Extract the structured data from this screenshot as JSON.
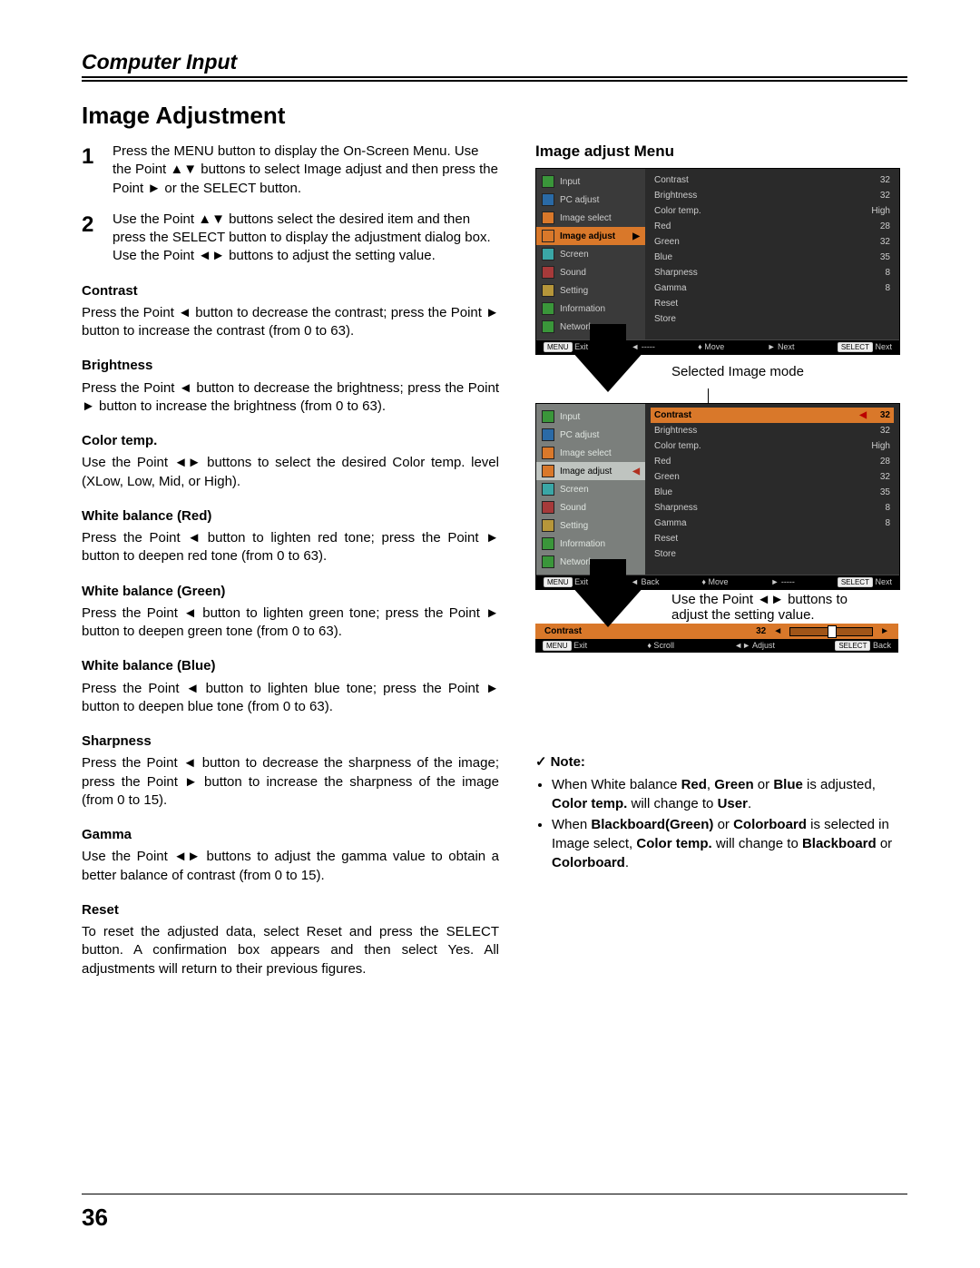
{
  "header": {
    "section": "Computer Input"
  },
  "title": "Image Adjustment",
  "steps": [
    {
      "num": "1",
      "text": "Press the MENU button to display the On-Screen Menu. Use the Point ▲▼ buttons to select Image adjust and then press the Point ► or the SELECT button."
    },
    {
      "num": "2",
      "text": "Use the Point ▲▼ buttons select the desired item and then press the SELECT button to display the adjustment dialog box. Use the Point ◄► buttons to adjust the setting value."
    }
  ],
  "settings": [
    {
      "name": "Contrast",
      "desc": "Press the Point ◄ button to decrease the contrast; press the Point ► button to increase the contrast (from 0 to 63)."
    },
    {
      "name": "Brightness",
      "desc": "Press the Point ◄ button to decrease the brightness; press the Point ► button to increase the brightness (from 0 to 63)."
    },
    {
      "name": "Color temp.",
      "desc": "Use the Point ◄► buttons to select the desired Color temp. level (XLow, Low, Mid, or High)."
    },
    {
      "name": "White balance (Red)",
      "desc": "Press the Point ◄ button to lighten red tone; press the Point ► button to deepen red tone (from 0 to 63)."
    },
    {
      "name": "White balance (Green)",
      "desc": "Press the Point ◄ button to lighten green tone; press the Point ► button to deepen green tone (from 0 to 63)."
    },
    {
      "name": "White balance (Blue)",
      "desc": "Press the Point ◄ button to lighten blue tone; press the Point ► button to deepen blue tone (from 0 to 63)."
    },
    {
      "name": "Sharpness",
      "desc": "Press the Point ◄ button to decrease the sharpness of the image; press the Point ► button to increase the sharpness of the image (from 0 to 15)."
    },
    {
      "name": "Gamma",
      "desc": "Use the Point ◄► buttons to adjust the gamma value to obtain a better balance of contrast (from 0 to 15)."
    },
    {
      "name": "Reset",
      "desc": "To reset the adjusted data, select Reset and press the SELECT button. A confirmation box appears and then select Yes. All adjustments will return to their previous figures."
    }
  ],
  "right": {
    "title": "Image adjust Menu",
    "selected_caption": "Selected Image mode",
    "hint": "Use the Point ◄► buttons to adjust the setting value."
  },
  "osd1": {
    "side": [
      {
        "label": "Input",
        "ic": "grn"
      },
      {
        "label": "PC adjust",
        "ic": "blu"
      },
      {
        "label": "Image select",
        "ic": "org"
      },
      {
        "label": "Image adjust",
        "ic": "org",
        "sel": true
      },
      {
        "label": "Screen",
        "ic": "cyn"
      },
      {
        "label": "Sound",
        "ic": "red"
      },
      {
        "label": "Setting",
        "ic": "yel"
      },
      {
        "label": "Information",
        "ic": "grn"
      },
      {
        "label": "Network",
        "ic": "grn"
      }
    ],
    "main": [
      {
        "k": "Contrast",
        "v": "32"
      },
      {
        "k": "Brightness",
        "v": "32"
      },
      {
        "k": "Color temp.",
        "v": "High"
      },
      {
        "k": "Red",
        "v": "28"
      },
      {
        "k": "Green",
        "v": "32"
      },
      {
        "k": "Blue",
        "v": "35"
      },
      {
        "k": "Sharpness",
        "v": "8"
      },
      {
        "k": "Gamma",
        "v": "8"
      },
      {
        "k": "Reset",
        "v": ""
      },
      {
        "k": "Store",
        "v": ""
      }
    ],
    "foot": {
      "exit": "MENU Exit",
      "back": "◄ -----",
      "move": "♦ Move",
      "next": "► Next",
      "sel": "SELECT Next"
    }
  },
  "osd2": {
    "side": [
      {
        "label": "Input",
        "ic": "grn"
      },
      {
        "label": "PC adjust",
        "ic": "blu"
      },
      {
        "label": "Image select",
        "ic": "org"
      },
      {
        "label": "Image adjust",
        "ic": "org",
        "sel": true
      },
      {
        "label": "Screen",
        "ic": "cyn"
      },
      {
        "label": "Sound",
        "ic": "red"
      },
      {
        "label": "Setting",
        "ic": "yel"
      },
      {
        "label": "Information",
        "ic": "grn"
      },
      {
        "label": "Network",
        "ic": "grn"
      }
    ],
    "main_hl": {
      "k": "Contrast",
      "v": "32"
    },
    "main": [
      {
        "k": "Brightness",
        "v": "32"
      },
      {
        "k": "Color temp.",
        "v": "High"
      },
      {
        "k": "Red",
        "v": "28"
      },
      {
        "k": "Green",
        "v": "32"
      },
      {
        "k": "Blue",
        "v": "35"
      },
      {
        "k": "Sharpness",
        "v": "8"
      },
      {
        "k": "Gamma",
        "v": "8"
      },
      {
        "k": "Reset",
        "v": ""
      },
      {
        "k": "Store",
        "v": ""
      }
    ],
    "foot": {
      "exit": "MENU Exit",
      "back": "◄ Back",
      "move": "♦ Move",
      "next": "► -----",
      "sel": "SELECT Next"
    }
  },
  "slider": {
    "label": "Contrast",
    "value": "32",
    "foot": {
      "exit": "MENU Exit",
      "scroll": "♦ Scroll",
      "adjust": "◄► Adjust",
      "back": "SELECT Back"
    }
  },
  "note": {
    "title": "Note:",
    "items": [
      "When White balance Red, Green or Blue is adjusted, Color temp. will change to User.",
      "When Blackboard(Green) or Colorboard is selected in Image select, Color temp. will change to Blackboard or Colorboard."
    ]
  },
  "page_number": "36"
}
